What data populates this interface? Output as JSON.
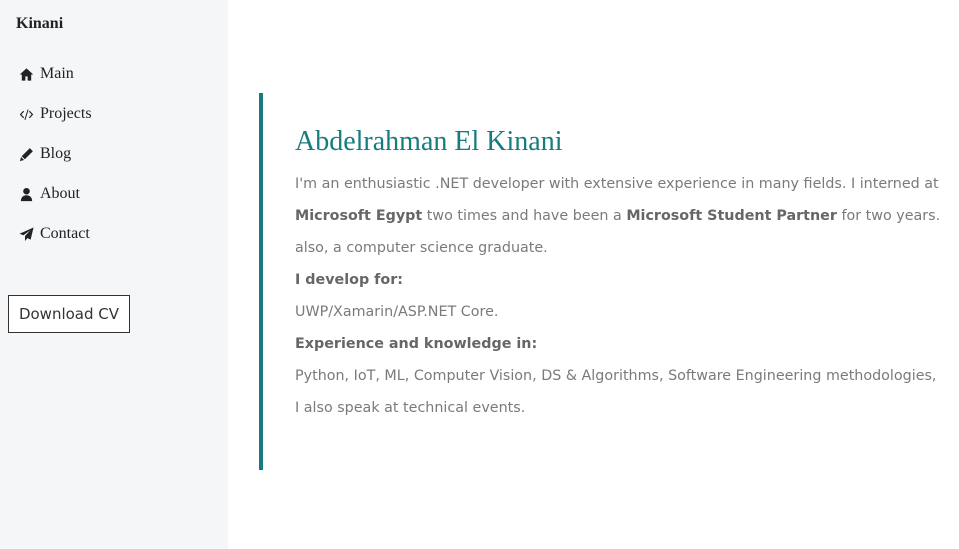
{
  "colors": {
    "accent": "#177c7e",
    "sidebar_bg": "#f5f6f8",
    "text_muted": "#7a7a7a"
  },
  "sidebar": {
    "brand": "Kinani",
    "items": [
      {
        "label": "Main",
        "icon": "home-icon"
      },
      {
        "label": "Projects",
        "icon": "code-icon"
      },
      {
        "label": "Blog",
        "icon": "pencil-icon"
      },
      {
        "label": "About",
        "icon": "user-icon"
      },
      {
        "label": "Contact",
        "icon": "paper-plane-icon"
      }
    ],
    "download_label": "Download CV"
  },
  "main": {
    "name": "Abdelrahman El Kinani",
    "bio": {
      "p1_a": "I'm an enthusiastic .NET developer with extensive experience in many fields. I interned at ",
      "p1_b1": "Microsoft Egypt",
      "p1_c": " two times and have been a ",
      "p1_b2": "Microsoft Student Partner",
      "p1_d": " for two years. also, a computer science graduate.",
      "develop_heading": "I develop for:",
      "develop_text": "UWP/Xamarin/ASP.NET Core.",
      "experience_heading": "Experience and knowledge in:",
      "experience_text": "Python, IoT, ML, Computer Vision, DS & Algorithms, Software Engineering methodologies, I also speak at technical events."
    }
  }
}
